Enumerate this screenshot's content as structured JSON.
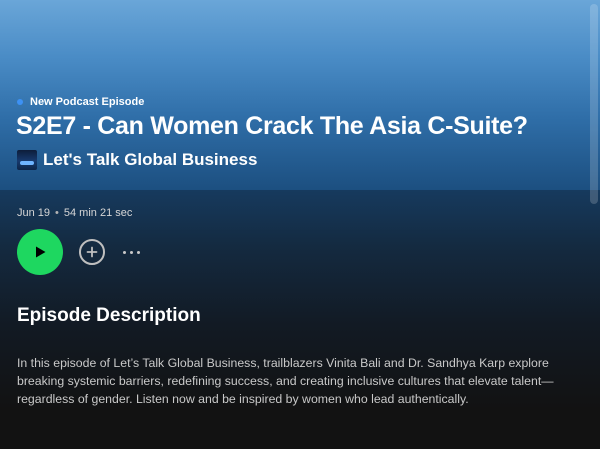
{
  "episode": {
    "eyebrow": "New Podcast Episode",
    "title": "S2E7 - Can Women Crack The Asia C-Suite?",
    "show_name": "Let's Talk Global Business",
    "date": "Jun 19",
    "separator": "•",
    "duration": "54 min 21 sec"
  },
  "controls": {
    "play_icon": "play-icon",
    "add_icon": "plus-circle-icon",
    "more_icon": "more-horizontal-icon"
  },
  "description": {
    "heading": "Episode Description",
    "text": "In this episode of Let’s Talk Global Business, trailblazers Vinita Bali and Dr. Sandhya Karp explore breaking systemic barriers, redefining success, and creating inclusive cultures that elevate talent—regardless of gender. Listen now and be inspired by women who lead authentically."
  },
  "colors": {
    "accent_green": "#1ed760",
    "new_badge_dot": "#3d91f4",
    "hero_top": "#6aa6d8",
    "hero_bottom": "#1c4f80",
    "background": "#121212"
  }
}
